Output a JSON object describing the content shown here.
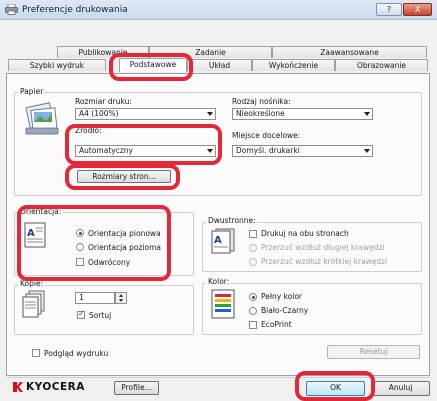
{
  "window": {
    "title": "Preferencje drukowania",
    "help_glyph": "?",
    "close_glyph": "X"
  },
  "tabs_top": [
    "Publikowanie",
    "Zadanie",
    "Zaawansowane"
  ],
  "tabs_bottom": [
    "Szybki wydruk",
    "Podstawowe",
    "Układ",
    "Wykończenie",
    "Obrazowanie"
  ],
  "paper": {
    "group_label": "Papier",
    "print_size_label": "Rozmiar druku:",
    "print_size_value": "A4  (100%)",
    "media_type_label": "Rodzaj nośnika:",
    "media_type_value": "Nieokreślone",
    "source_label": "Źródło:",
    "source_value": "Automatyczny",
    "destination_label": "Miejsce docelowe:",
    "destination_value": "Domyśl. drukarki",
    "page_sizes_button": "Rozmiary stron..."
  },
  "orientation": {
    "group_label": "Orientacja:",
    "options": [
      "Orientacja pionowa",
      "Orientacja pozioma"
    ],
    "selected": "Orientacja pionowa",
    "rotated_label": "Odwrócony",
    "rotated_checked": false
  },
  "duplex": {
    "group_label": "Dwustronne:",
    "both_sides_label": "Drukuj na obu stronach",
    "both_sides_checked": false,
    "flip_long": "Przerzuć wzdłuż długiej krawędzi",
    "flip_short": "Przerzuć wzdłuż krótkiej krawędzi"
  },
  "copies": {
    "group_label": "Kopie:",
    "value": "1",
    "collate_label": "Sortuj",
    "collate_checked": true
  },
  "color": {
    "group_label": "Kolor:",
    "options": [
      "Pełny kolor",
      "Biało-Czarny"
    ],
    "selected": "Pełny kolor",
    "ecoprint_label": "EcoPrint",
    "ecoprint_checked": false
  },
  "preview_label": "Podgląd wydruku",
  "reset_button": "Resetuj",
  "footer": {
    "brand": "KYOCERA",
    "profile_button": "Profile...",
    "ok_button": "OK",
    "cancel_button": "Anuluj"
  },
  "colors": {
    "highlight": "#e3283a",
    "brand_red": "#d1111b",
    "selection_blue": "#1e4fa3"
  }
}
